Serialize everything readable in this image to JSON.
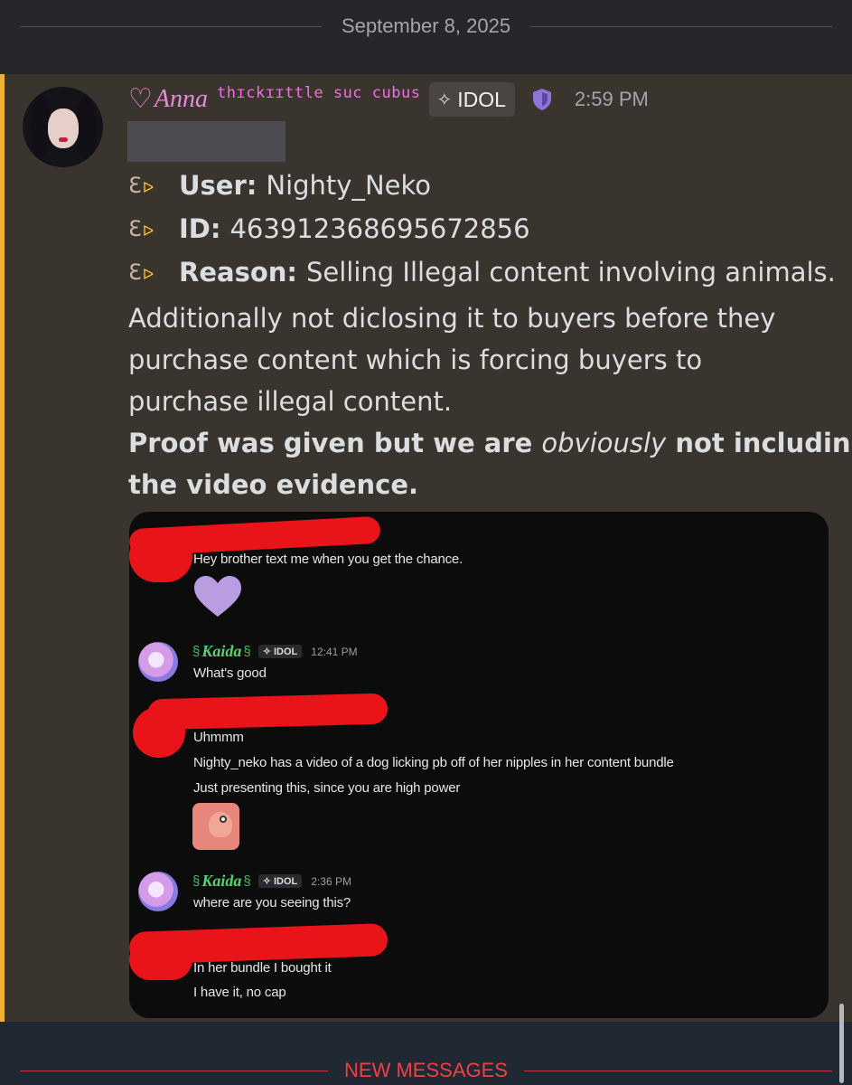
{
  "date_divider": "September 8, 2025",
  "message": {
    "author": "Anna",
    "author_subtitle": "thɪckɪɪttle suc cubus",
    "tag_label": "IDOL",
    "timestamp": "2:59 PM",
    "fields": [
      {
        "label": "User:",
        "value": "Nighty_Neko"
      },
      {
        "label": "ID:",
        "value": "463912368695672856"
      },
      {
        "label": "Reason:",
        "value": "Selling Illegal content involving animals."
      }
    ],
    "reason_continued": [
      "Additionally not diclosing it to buyers before they",
      "purchase content which is forcing buyers to",
      "purchase illegal content."
    ],
    "proof_line1_a": "Proof was given but we are ",
    "proof_line1_em": "obviously",
    "proof_line1_b": " not including",
    "proof_line2": "the video evidence."
  },
  "attachment": {
    "lines": {
      "hey": "Hey brother text me when you get the chance.",
      "whats_good": "What's good",
      "uhmmm": "Uhmmm",
      "nighty": "Nighty_neko has a video of a dog licking pb off of her nipples in her content bundle",
      "presenting": "Just presenting this, since you are high power",
      "where": "where are you seeing this?",
      "bundle": "In her bundle I bought it",
      "nocap": "I have it, no cap"
    },
    "kaida": {
      "name": "Kaida",
      "tag": "IDOL",
      "time1": "12:41 PM",
      "time2": "2:36 PM"
    }
  },
  "new_messages": "NEW MESSAGES",
  "colors": {
    "accent_bar": "#f0b232",
    "author": "#e88ad8",
    "new_messages": "#f23f42",
    "redaction": "#e8141a"
  }
}
